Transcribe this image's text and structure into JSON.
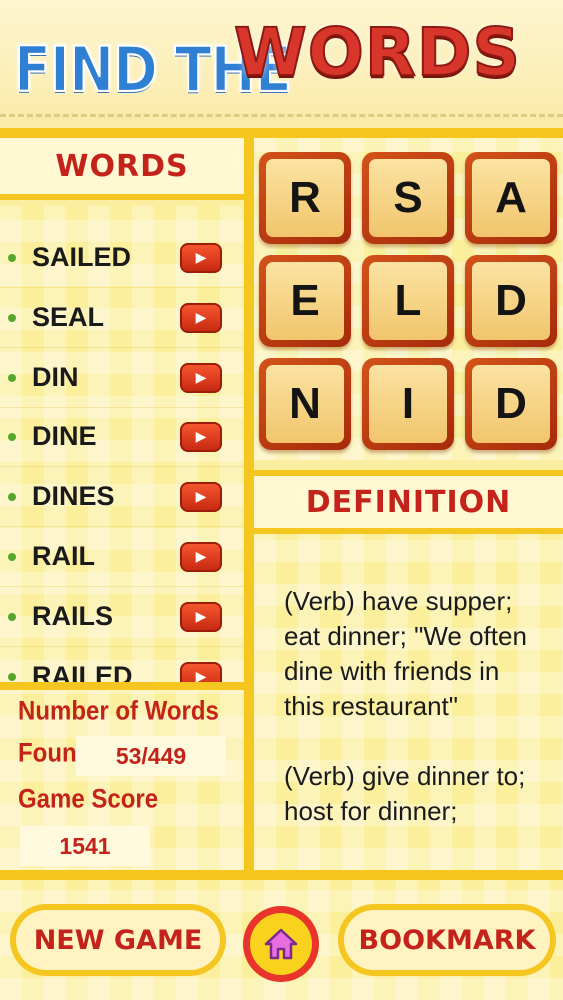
{
  "header": {
    "title_part1": "FIND THE",
    "title_part2": "WORDS"
  },
  "words_panel": {
    "heading": "WORDS",
    "items": [
      {
        "label": "SAILED"
      },
      {
        "label": "SEAL"
      },
      {
        "label": "DIN"
      },
      {
        "label": "DINE"
      },
      {
        "label": "DINES"
      },
      {
        "label": "RAIL"
      },
      {
        "label": "RAILS"
      },
      {
        "label": "RAILED"
      }
    ]
  },
  "stats": {
    "number_of_words_label": "Number of Words",
    "found_label": "Found",
    "found_value": "53/449",
    "game_score_label": "Game Score",
    "game_score_value": "1541"
  },
  "grid": {
    "letters": [
      "R",
      "S",
      "A",
      "E",
      "L",
      "D",
      "N",
      "I",
      "D"
    ]
  },
  "definition": {
    "heading": "DEFINITION",
    "paragraphs": [
      "(Verb) have supper; eat dinner; \"We often dine with friends in this restaurant\"",
      "(Verb) give dinner to; host for dinner;"
    ]
  },
  "bottom_bar": {
    "new_game_label": "NEW GAME",
    "bookmark_label": "BOOKMARK",
    "home_icon": "home-icon"
  },
  "colors": {
    "accent_red": "#c4231c",
    "title_blue": "#2f7fd3",
    "border_yellow": "#f5c520",
    "bullet_green": "#58a52b"
  }
}
